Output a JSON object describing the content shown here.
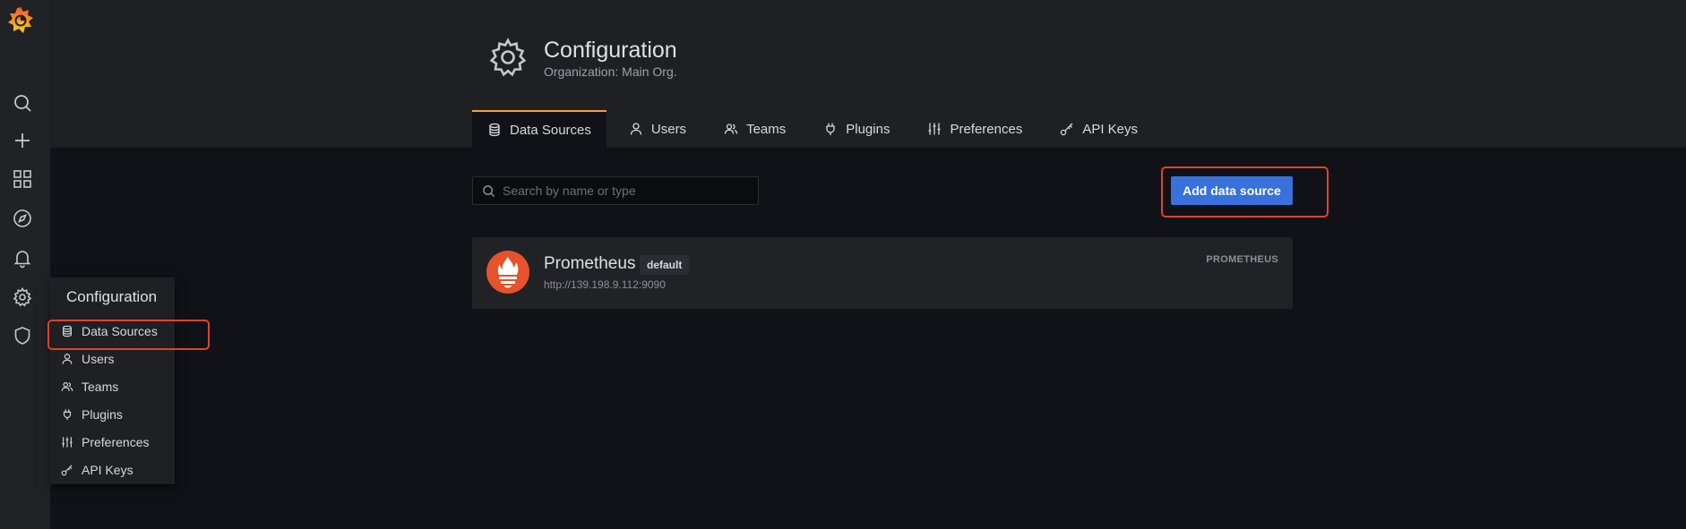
{
  "sidebar": {
    "icons": [
      "grafana-logo-icon",
      "search-icon",
      "plus-icon",
      "dashboards-icon",
      "explore-icon",
      "alert-bell-icon",
      "gear-icon",
      "shield-icon"
    ]
  },
  "header": {
    "title": "Configuration",
    "subtitle": "Organization: Main Org."
  },
  "tabs": [
    {
      "label": "Data Sources",
      "icon": "database-icon",
      "active": true
    },
    {
      "label": "Users",
      "icon": "user-icon"
    },
    {
      "label": "Teams",
      "icon": "teams-icon"
    },
    {
      "label": "Plugins",
      "icon": "plug-icon"
    },
    {
      "label": "Preferences",
      "icon": "sliders-icon"
    },
    {
      "label": "API Keys",
      "icon": "key-icon"
    }
  ],
  "search": {
    "placeholder": "Search by name or type",
    "value": ""
  },
  "add_button": {
    "label": "Add data source"
  },
  "datasources": [
    {
      "name": "Prometheus",
      "badge": "default",
      "url": "http://139.198.9.112:9090",
      "type": "PROMETHEUS"
    }
  ],
  "flyout": {
    "title": "Configuration",
    "items": [
      {
        "label": "Data Sources",
        "icon": "database-icon"
      },
      {
        "label": "Users",
        "icon": "user-icon"
      },
      {
        "label": "Teams",
        "icon": "teams-icon"
      },
      {
        "label": "Plugins",
        "icon": "plug-icon"
      },
      {
        "label": "Preferences",
        "icon": "sliders-icon"
      },
      {
        "label": "API Keys",
        "icon": "key-icon"
      }
    ]
  },
  "colors": {
    "accent_orange": "#f5a03c",
    "primary_blue": "#3871dc",
    "highlight_red": "#e0422b",
    "prometheus_orange": "#e6522c"
  }
}
